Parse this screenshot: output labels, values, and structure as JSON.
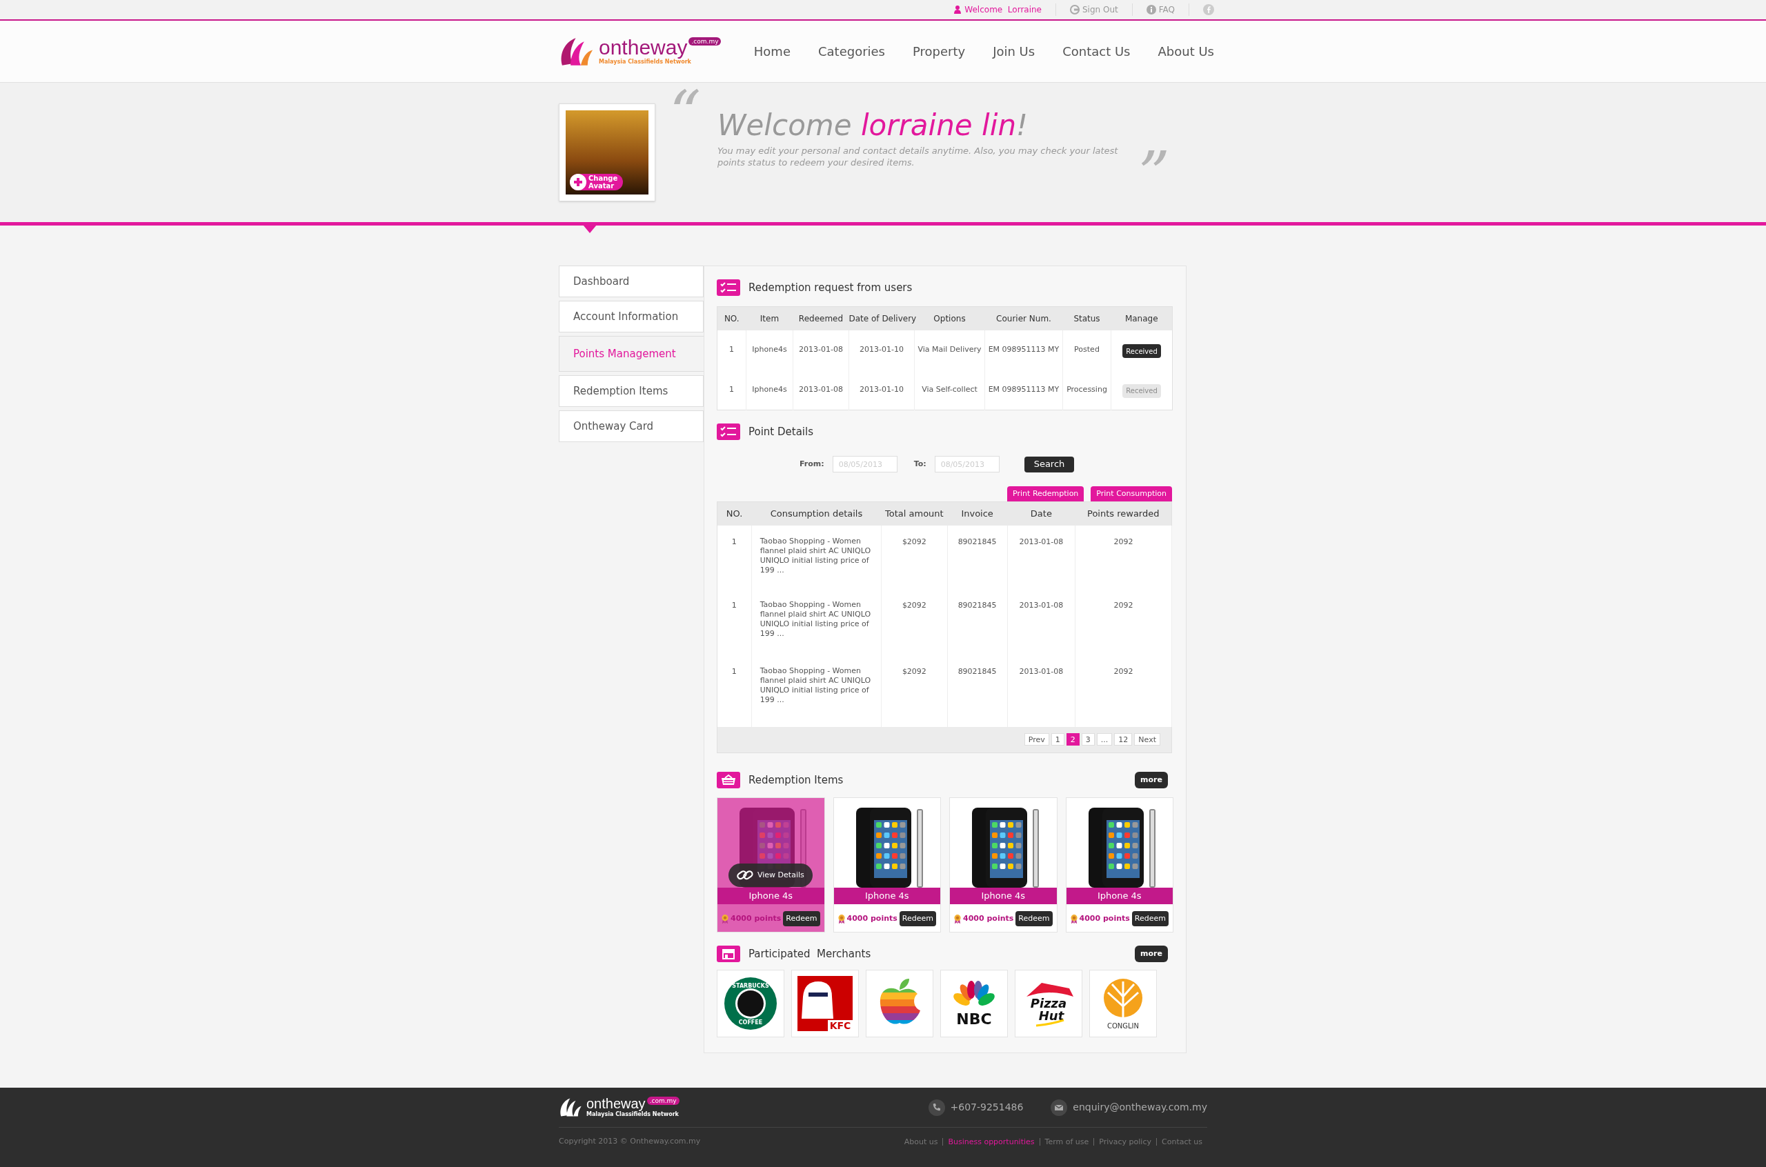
{
  "top_bar": {
    "welcome": "Welcome",
    "user": "Lorraine",
    "links": [
      {
        "kind": "signout",
        "label": "Sign Out"
      },
      {
        "kind": "info",
        "label": "FAQ"
      }
    ]
  },
  "header": {
    "logo": {
      "name": "ontheway",
      "domain": ".com.my",
      "tagline": "Malaysia Classifields Network"
    },
    "nav": [
      "Home",
      "Categories",
      "Property",
      "Join Us",
      "Contact Us",
      "About Us"
    ]
  },
  "welcome": {
    "change_avatar": [
      "Change",
      "Avatar"
    ],
    "open_quote": "“",
    "greeting": "Welcome",
    "name": "lorraine lin",
    "exclamation": "!",
    "message": "You may edit your personal and contact details anytime. Also, you may check your latest points status to redeem your desired items.",
    "close_quote": "”"
  },
  "sidebar": {
    "items": [
      {
        "label": "Dashboard",
        "selected": false
      },
      {
        "label": "Account Information",
        "selected": false
      },
      {
        "label": "Points Management",
        "selected": true
      },
      {
        "label": "Redemption Items",
        "selected": false
      },
      {
        "label": "Ontheway Card",
        "selected": false
      }
    ]
  },
  "redemption_requests": {
    "title": "Redemption request from users",
    "columns": [
      "NO.",
      "Item",
      "Redeemed",
      "Date of Delivery",
      "Options",
      "Courier Num.",
      "Status",
      "Manage"
    ],
    "rows": [
      {
        "cells": [
          "1",
          "Iphone4s",
          "2013-01-08",
          "2013-01-10",
          "Via Mail Delivery",
          "EM 098951113 MY",
          "Posted"
        ],
        "action": {
          "label": "Received",
          "disabled": false
        }
      },
      {
        "cells": [
          "1",
          "Iphone4s",
          "2013-01-08",
          "2013-01-10",
          "Via Self-collect",
          "EM 098951113 MY",
          "Processing"
        ],
        "action": {
          "label": "Received",
          "disabled": true
        }
      }
    ]
  },
  "point_details": {
    "title": "Point Details",
    "from_label": "From:",
    "from_placeholder": "08/05/2013",
    "to_label": "To:",
    "to_placeholder": "08/05/2013",
    "search": "Search",
    "print_buttons": [
      "Print Redemption",
      "Print Consumption"
    ],
    "columns": [
      "NO.",
      "Consumption details",
      "Total amount",
      "Invoice",
      "Date",
      "Points rewarded"
    ],
    "rows": [
      [
        "1",
        "Taobao Shopping - Women flannel plaid shirt AC UNIQLO UNIQLO initial listing price of 199 ...",
        "$2092",
        "89021845",
        "2013-01-08",
        "2092"
      ],
      [
        "1",
        "Taobao Shopping - Women flannel plaid shirt AC UNIQLO UNIQLO initial listing price of 199 ...",
        "$2092",
        "89021845",
        "2013-01-08",
        "2092"
      ],
      [
        "1",
        "Taobao Shopping - Women flannel plaid shirt AC UNIQLO UNIQLO initial listing price of 199 ...",
        "$2092",
        "89021845",
        "2013-01-08",
        "2092"
      ]
    ],
    "pagination": [
      {
        "label": "Prev",
        "selected": false
      },
      {
        "label": "1",
        "selected": false
      },
      {
        "label": "2",
        "selected": true
      },
      {
        "label": "3",
        "selected": false
      },
      {
        "label": "...",
        "selected": false
      },
      {
        "label": "12",
        "selected": false
      },
      {
        "label": "Next",
        "selected": false
      }
    ]
  },
  "redemption_items": {
    "title": "Redemption Items",
    "more": "more",
    "view_details": "View Details",
    "items": [
      {
        "name": "Iphone 4s",
        "points": "4000 points",
        "redeem": "Redeem",
        "hovered": true
      },
      {
        "name": "Iphone 4s",
        "points": "4000 points",
        "redeem": "Redeem",
        "hovered": false
      },
      {
        "name": "Iphone 4s",
        "points": "4000 points",
        "redeem": "Redeem",
        "hovered": false
      },
      {
        "name": "Iphone 4s",
        "points": "4000 points",
        "redeem": "Redeem",
        "hovered": false
      }
    ]
  },
  "merchants": {
    "title": "Participated  Merchants",
    "more": "more",
    "items": [
      {
        "kind": "starbucks",
        "logo_text": [
          "STARBUCKS",
          "COFFEE"
        ]
      },
      {
        "kind": "kfc",
        "logo_text": [
          "KFC"
        ]
      },
      {
        "kind": "apple"
      },
      {
        "kind": "nbc",
        "logo_text": [
          "NBC"
        ]
      },
      {
        "kind": "pizzahut",
        "logo_text": [
          "Pizza",
          "Hut"
        ]
      },
      {
        "kind": "conglin",
        "logo_text": [
          "CONGLIN"
        ]
      }
    ]
  },
  "footer": {
    "logo": {
      "name": "ontheway",
      "domain": ".com.my",
      "tagline": "Malaysia Classifields Network"
    },
    "phone": "+607-9251486",
    "email": "enquiry@ontheway.com.my",
    "copyright": "Copyright 2013 © Ontheway.com.my",
    "links": [
      {
        "label": "About us",
        "highlighted": false
      },
      {
        "label": "Business opportunities",
        "highlighted": true
      },
      {
        "label": "Term of use",
        "highlighted": false
      },
      {
        "label": "Privacy policy",
        "highlighted": false
      },
      {
        "label": "Contact us",
        "highlighted": false
      }
    ]
  }
}
